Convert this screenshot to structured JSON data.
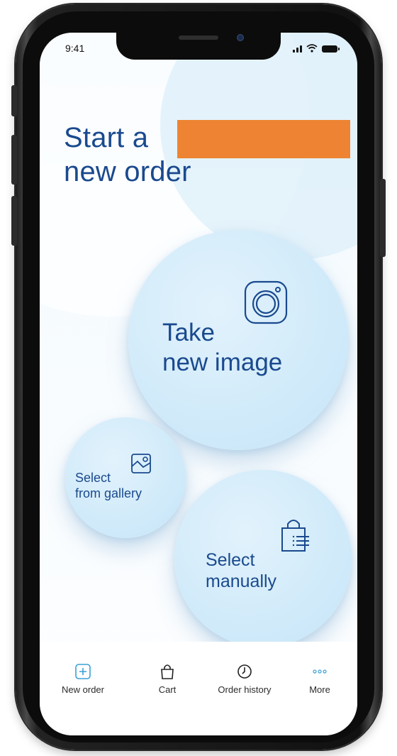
{
  "status_bar": {
    "time": "9:41"
  },
  "headline": {
    "line1": "Start a",
    "line2": "new order"
  },
  "actions": {
    "take_new_image": {
      "line1": "Take",
      "line2": "new image"
    },
    "select_from_gallery": {
      "line1": "Select",
      "line2": "from gallery"
    },
    "select_manually": {
      "line1": "Select",
      "line2": "manually"
    }
  },
  "tab_bar": {
    "items": [
      {
        "label": "New order",
        "icon": "plus-square-icon"
      },
      {
        "label": "Cart",
        "icon": "shopping-bag-icon"
      },
      {
        "label": "Order history",
        "icon": "clock-icon"
      },
      {
        "label": "More",
        "icon": "more-dots-icon"
      }
    ],
    "active_index": 0
  },
  "colors": {
    "brand_blue": "#1a4a8e",
    "icon_blue": "#3aa0d8",
    "bubble": "#d2ebfa",
    "redaction": "#ee8433"
  }
}
